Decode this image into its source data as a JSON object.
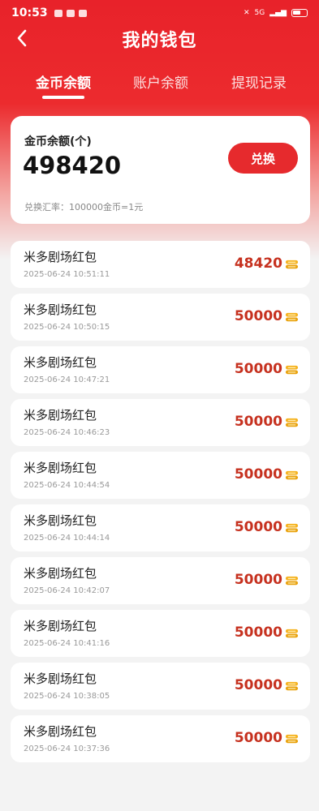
{
  "status_bar": {
    "time": "10:53",
    "network": "5G"
  },
  "header": {
    "title": "我的钱包"
  },
  "tabs": [
    {
      "label": "金币余额",
      "active": true
    },
    {
      "label": "账户余额",
      "active": false
    },
    {
      "label": "提现记录",
      "active": false
    }
  ],
  "balance_card": {
    "label": "金币余额(个)",
    "value": "498420",
    "exchange_label": "兑换",
    "rate_text": "兑换汇率：100000金币=1元"
  },
  "records": [
    {
      "title": "米多剧场红包",
      "time": "2025-06-24 10:51:11",
      "amount": "48420"
    },
    {
      "title": "米多剧场红包",
      "time": "2025-06-24 10:50:15",
      "amount": "50000"
    },
    {
      "title": "米多剧场红包",
      "time": "2025-06-24 10:47:21",
      "amount": "50000"
    },
    {
      "title": "米多剧场红包",
      "time": "2025-06-24 10:46:23",
      "amount": "50000"
    },
    {
      "title": "米多剧场红包",
      "time": "2025-06-24 10:44:54",
      "amount": "50000"
    },
    {
      "title": "米多剧场红包",
      "time": "2025-06-24 10:44:14",
      "amount": "50000"
    },
    {
      "title": "米多剧场红包",
      "time": "2025-06-24 10:42:07",
      "amount": "50000"
    },
    {
      "title": "米多剧场红包",
      "time": "2025-06-24 10:41:16",
      "amount": "50000"
    },
    {
      "title": "米多剧场红包",
      "time": "2025-06-24 10:38:05",
      "amount": "50000"
    },
    {
      "title": "米多剧场红包",
      "time": "2025-06-24 10:37:36",
      "amount": "50000"
    }
  ],
  "colors": {
    "brand_red": "#e62a2d",
    "amount_red": "#c6311f",
    "coin_gold": "#f5b21f"
  },
  "icons": {
    "back": "chevron-left-icon",
    "coin": "coin-stack-icon"
  }
}
